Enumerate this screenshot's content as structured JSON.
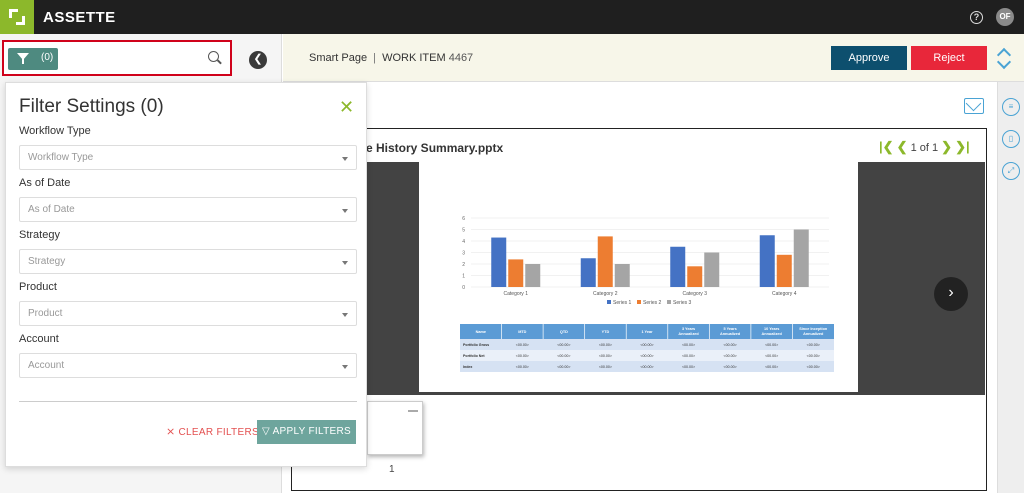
{
  "app": {
    "brand": "ASSETTE",
    "help_glyph": "?",
    "user_initials": "OF"
  },
  "search": {
    "filter_count": "(0)",
    "collapse_glyph": "❮"
  },
  "header": {
    "page_label": "Smart Page",
    "separator": "|",
    "work_item_label": "WORK ITEM",
    "work_item_number": "4467",
    "approve_label": "Approve",
    "reject_label": "Reject"
  },
  "filter": {
    "title": "Filter Settings (0)",
    "close_glyph": "✕",
    "fields": [
      {
        "label": "Workflow Type",
        "placeholder": "Workflow Type"
      },
      {
        "label": "As of Date",
        "placeholder": "As of Date"
      },
      {
        "label": "Strategy",
        "placeholder": "Strategy"
      },
      {
        "label": "Product",
        "placeholder": "Product"
      },
      {
        "label": "Account",
        "placeholder": "Account"
      }
    ],
    "clear_label": "CLEAR FILTERS",
    "apply_label": "APPLY FILTERS"
  },
  "document": {
    "title": "e History Summary.pptx",
    "page_indicator": "1 of 1",
    "thumb_number": "1",
    "next_glyph": "›"
  },
  "chart_data": {
    "type": "bar",
    "categories": [
      "Category 1",
      "Category 2",
      "Category 3",
      "Category 4"
    ],
    "series": [
      {
        "name": "Series 1",
        "values": [
          4.3,
          2.5,
          3.5,
          4.5
        ]
      },
      {
        "name": "Series 2",
        "values": [
          2.4,
          4.4,
          1.8,
          2.8
        ]
      },
      {
        "name": "Series 3",
        "values": [
          2.0,
          2.0,
          3.0,
          5.0
        ]
      }
    ],
    "ylim": [
      0,
      6
    ],
    "yticks": [
      "0",
      "1",
      "2",
      "3",
      "4",
      "5",
      "6"
    ],
    "colors": [
      "#4472c4",
      "#ed7d31",
      "#a5a5a5"
    ],
    "grid": true,
    "legend_position": "bottom"
  },
  "slide_table": {
    "headers": [
      "Name",
      "MTD",
      "QTD",
      "YTD",
      "1 Year",
      "3 Years Annualized",
      "5 Years Annualized",
      "10 Years Annualized",
      "Since Inception Annualized"
    ],
    "rows": [
      [
        "Portfolio Gross",
        "<00.00>",
        "<00.00>",
        "<00.00>",
        "<00.00>",
        "<00.00>",
        "<00.00>",
        "<00.00>",
        "<00.00>"
      ],
      [
        "Portfolio Net",
        "<00.00>",
        "<00.00>",
        "<00.00>",
        "<00.00>",
        "<00.00>",
        "<00.00>",
        "<00.00>",
        "<00.00>"
      ],
      [
        "Index",
        "<00.00>",
        "<00.00>",
        "<00.00>",
        "<00.00>",
        "<00.00>",
        "<00.00>",
        "<00.00>",
        "<00.00>"
      ]
    ]
  }
}
